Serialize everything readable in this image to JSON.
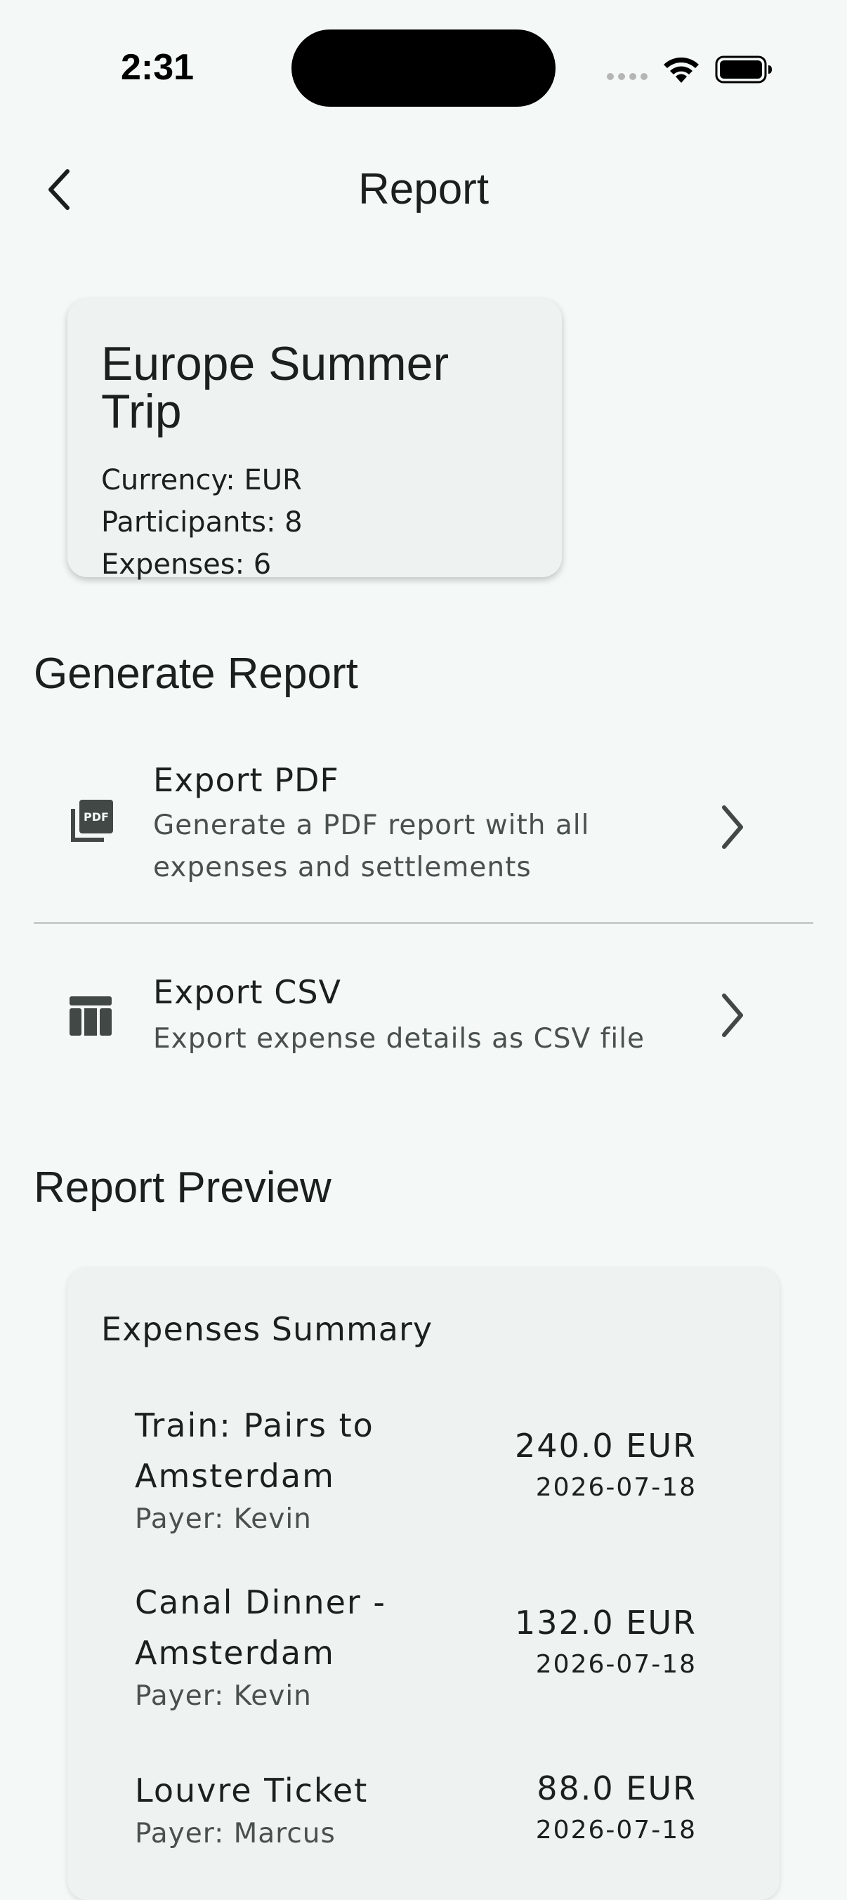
{
  "status_bar": {
    "time": "2:31"
  },
  "app_bar": {
    "title": "Report",
    "back_icon": "chevron-left-icon"
  },
  "trip": {
    "name": "Europe Summer Trip",
    "currency": "Currency: EUR",
    "participants": "Participants: 8",
    "expenses": "Expenses: 6"
  },
  "generate": {
    "heading": "Generate Report",
    "options": [
      {
        "icon": "pdf-icon",
        "title": "Export PDF",
        "description": "Generate a PDF report with all expenses and settlements"
      },
      {
        "icon": "table-icon",
        "title": "Export CSV",
        "description": "Export expense details as CSV file"
      }
    ]
  },
  "preview": {
    "heading": "Report Preview",
    "summary_title": "Expenses Summary",
    "expenses": [
      {
        "name": "Train: Pairs to Amsterdam",
        "payer": "Payer: Kevin",
        "amount": "240.0 EUR",
        "date": "2026-07-18"
      },
      {
        "name": "Canal Dinner - Amsterdam",
        "payer": "Payer: Kevin",
        "amount": "132.0 EUR",
        "date": "2026-07-18"
      },
      {
        "name": "Louvre Ticket",
        "payer": "Payer: Marcus",
        "amount": "88.0 EUR",
        "date": "2026-07-18"
      }
    ]
  }
}
